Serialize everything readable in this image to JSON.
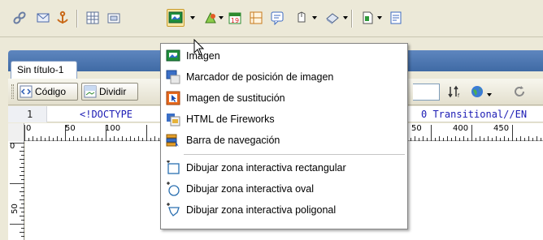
{
  "toolbar": {
    "buttons": [
      {
        "icon": "hyperlink-icon"
      },
      {
        "icon": "email-link-icon"
      },
      {
        "icon": "named-anchor-icon"
      },
      {
        "icon": "table-icon"
      },
      {
        "icon": "layer-icon"
      },
      {
        "icon": "image-icon",
        "active": true
      },
      {
        "icon": "media-icon"
      },
      {
        "icon": "date-icon"
      },
      {
        "icon": "comment-icon"
      },
      {
        "icon": "templates-icon"
      },
      {
        "icon": "tag-chooser-icon"
      },
      {
        "icon": "head-icon"
      },
      {
        "icon": "script-icon"
      },
      {
        "icon": "form-icon"
      }
    ]
  },
  "document": {
    "tab_title": "Sin título-1",
    "view_buttons": {
      "code": "Código",
      "split": "Dividir"
    },
    "code_view": {
      "line_number": "1",
      "code_left": "<!DOCTYPE ",
      "code_right": "0 Transitional//EN"
    },
    "ruler": {
      "top_labels": [
        "0",
        "50",
        "100",
        "50",
        "400",
        "450"
      ],
      "left_labels": [
        "0",
        "50"
      ]
    }
  },
  "menu": {
    "items": [
      {
        "label": "Imagen",
        "icon": "image-icon"
      },
      {
        "label": "Marcador de posición de imagen",
        "icon": "image-placeholder-icon"
      },
      {
        "label": "Imagen de sustitución",
        "icon": "rollover-image-icon"
      },
      {
        "label": "HTML de Fireworks",
        "icon": "fireworks-html-icon"
      },
      {
        "label": "Barra de navegación",
        "icon": "navigation-bar-icon"
      },
      {
        "label": "Dibujar zona interactiva rectangular",
        "icon": "rectangle-hotspot-icon"
      },
      {
        "label": "Dibujar zona interactiva oval",
        "icon": "oval-hotspot-icon"
      },
      {
        "label": "Dibujar zona interactiva poligonal",
        "icon": "polygon-hotspot-icon"
      }
    ]
  }
}
